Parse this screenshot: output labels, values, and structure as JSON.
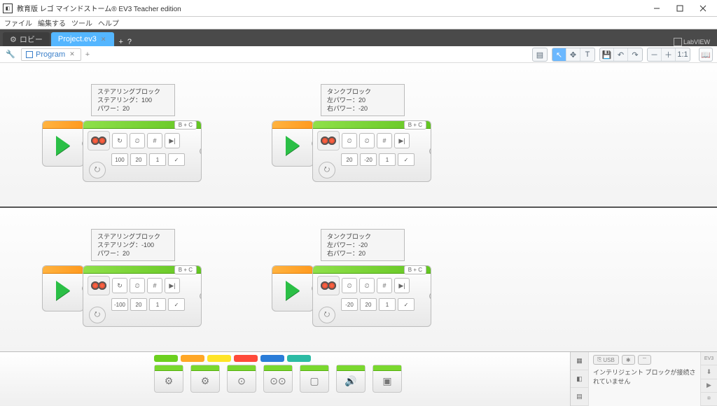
{
  "window": {
    "title": "教育版 レゴ マインドストーム® EV3 Teacher edition"
  },
  "menubar": [
    "ファイル",
    "編集する",
    "ツール",
    "ヘルプ"
  ],
  "apptabs": {
    "lobby": "ロビー",
    "project": "Project.ev3",
    "labview": "LabVIEW"
  },
  "program_tab": "Program",
  "port_label": "B + C",
  "programs": [
    {
      "tip_title": "ステアリングブロック",
      "tip_l1": "ステアリング：100",
      "tip_l2": "パワー：20",
      "vals": [
        "100",
        "20",
        "1",
        "✓"
      ]
    },
    {
      "tip_title": "タンクブロック",
      "tip_l1": "左パワー：20",
      "tip_l2": "右パワー：-20",
      "vals": [
        "20",
        "-20",
        "1",
        "✓"
      ]
    },
    {
      "tip_title": "ステアリングブロック",
      "tip_l1": "ステアリング：-100",
      "tip_l2": "パワー：20",
      "vals": [
        "-100",
        "20",
        "1",
        "✓"
      ]
    },
    {
      "tip_title": "タンクブロック",
      "tip_l1": "左パワー：-20",
      "tip_l2": "右パワー：20",
      "vals": [
        "-20",
        "20",
        "1",
        "✓"
      ]
    }
  ],
  "status": {
    "usb": "USB",
    "ev3": "EV3",
    "msg": "インテリジェント ブロックが接続されていません"
  },
  "toolbar": {
    "1_1": "1:1"
  }
}
